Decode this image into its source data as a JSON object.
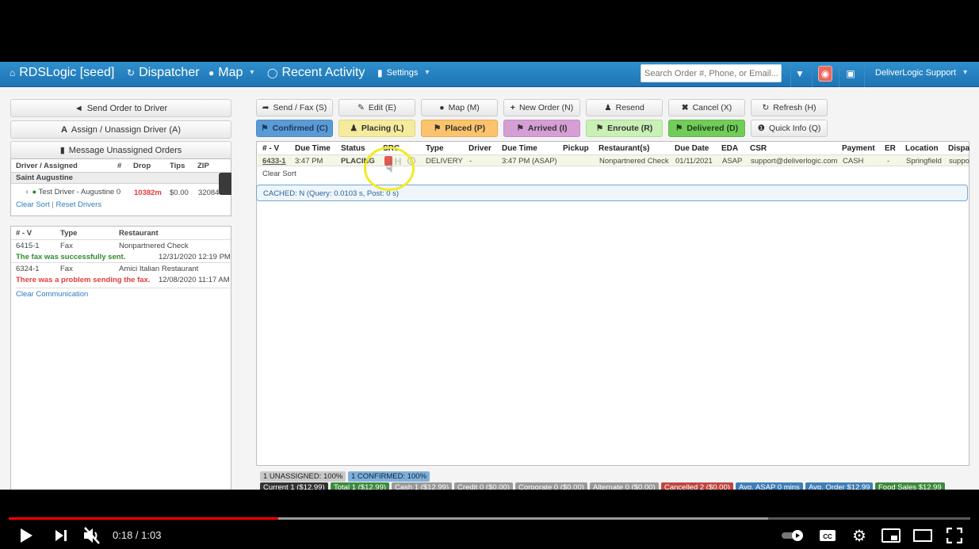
{
  "navbar": {
    "brand": "RDSLogic [seed]",
    "dispatcher": "Dispatcher",
    "map": "Map",
    "recent_activity": "Recent Activity",
    "settings": "Settings",
    "search_placeholder": "Search Order #, Phone, or Email...",
    "user": "DeliverLogic Support"
  },
  "left": {
    "send_order": "Send Order to Driver",
    "assign_driver": "Assign / Unassign Driver (A)",
    "message_unassigned": "Message Unassigned Orders",
    "driver_table": {
      "headers": [
        "Driver / Assigned",
        "#",
        "Drop",
        "Tips",
        "ZIP"
      ],
      "group": "Saint Augustine",
      "rows": [
        {
          "name": "Test Driver - Augustine",
          "count": "0",
          "drop": "10382m",
          "tips": "$0.00",
          "zip": "32084"
        }
      ],
      "clear_sort": "Clear Sort",
      "separator": "|",
      "reset_drivers": "Reset Drivers"
    },
    "comm_table": {
      "headers": [
        "# - V",
        "Type",
        "Restaurant"
      ],
      "rows": [
        {
          "id": "6415-1",
          "type": "Fax",
          "restaurant": "Nonpartnered Check",
          "message": "The fax was successfully sent.",
          "status": "success",
          "time": "12/31/2020 12:19 PM"
        },
        {
          "id": "6324-1",
          "type": "Fax",
          "restaurant": "Amici Italian Restaurant",
          "message": "There was a problem sending the fax.",
          "status": "error",
          "time": "12/08/2020 11:17 AM"
        }
      ],
      "clear": "Clear Communication"
    }
  },
  "actions": {
    "row1": [
      {
        "label": "Send / Fax (S)",
        "icon": "share-icon"
      },
      {
        "label": "Edit (E)",
        "icon": "edit-icon"
      },
      {
        "label": "Map (M)",
        "icon": "globe-icon"
      },
      {
        "label": "New Order (N)",
        "icon": "plus-icon"
      },
      {
        "label": "Resend",
        "icon": "user-icon"
      },
      {
        "label": "Cancel (X)",
        "icon": "x-icon"
      },
      {
        "label": "Refresh (H)",
        "icon": "refresh-icon"
      }
    ],
    "row2": [
      {
        "label": "Confirmed (C)",
        "color": "#5b9bd5"
      },
      {
        "label": "Placing (L)",
        "color": "#f5eb9c"
      },
      {
        "label": "Placed (P)",
        "color": "#fbc36b"
      },
      {
        "label": "Arrived (I)",
        "color": "#d59fd6"
      },
      {
        "label": "Enroute (R)",
        "color": "#c9f0b5"
      },
      {
        "label": "Delivered (D)",
        "color": "#72cc5a"
      },
      {
        "label": "Quick Info (Q)",
        "color": "#f2f2f2"
      }
    ]
  },
  "orders": {
    "headers": [
      "# - V",
      "Due Time",
      "Status",
      "SRC",
      "Type",
      "Driver",
      "Due Time",
      "Pickup",
      "Restaurant(s)",
      "Due Date",
      "EDA",
      "CSR",
      "Payment",
      "ER",
      "Location",
      "Dispa"
    ],
    "rows": [
      {
        "id": "6433-1",
        "due_time": "3:47 PM",
        "status": "PLACING",
        "src": "|-|",
        "type": "DELIVERY",
        "driver": "-",
        "due_time2": "3:47 PM (ASAP)",
        "pickup": "",
        "restaurant": "Nonpartnered Check",
        "due_date": "01/11/2021",
        "eda": "ASAP",
        "csr": "support@deliverlogic.com",
        "payment": "CASH",
        "er": "-",
        "location": "Springfield",
        "dispatcher": "suppo"
      }
    ],
    "clear_sort": "Clear Sort",
    "cached": "CACHED: N (Query: 0.0103 s, Post: 0 s)"
  },
  "summary": {
    "row1": [
      {
        "label": "1 UNASSIGNED: 100%",
        "bg": "#c8c8c8",
        "fg": "#222"
      },
      {
        "label": "1 CONFIRMED: 100%",
        "bg": "#7fb0dc",
        "fg": "#123"
      }
    ],
    "row2": [
      {
        "label": "Current 1 ($12.99)",
        "bg": "#333",
        "fg": "#fff"
      },
      {
        "label": "Total 1 ($12.99)",
        "bg": "#3c8a3c",
        "fg": "#fff"
      },
      {
        "label": "Cash 1 ($12.99)",
        "bg": "#999",
        "fg": "#fff"
      },
      {
        "label": "Credit 0 ($0.00)",
        "bg": "#999",
        "fg": "#fff"
      },
      {
        "label": "Corporate 0 ($0.00)",
        "bg": "#999",
        "fg": "#fff"
      },
      {
        "label": "Alternate 0 ($0.00)",
        "bg": "#999",
        "fg": "#fff"
      },
      {
        "label": "Cancelled 2 ($0.00)",
        "bg": "#c0463f",
        "fg": "#fff"
      },
      {
        "label": "Avg. ASAP 0 mins",
        "bg": "#3f7fb8",
        "fg": "#fff"
      },
      {
        "label": "Avg. Order $12.99",
        "bg": "#3f7fb8",
        "fg": "#fff"
      },
      {
        "label": "Food Sales $12.99",
        "bg": "#3c8a3c",
        "fg": "#fff"
      }
    ]
  },
  "player": {
    "time": "0:18 / 1:03",
    "played_fraction": 0.28,
    "buffered_fraction": 0.79
  }
}
